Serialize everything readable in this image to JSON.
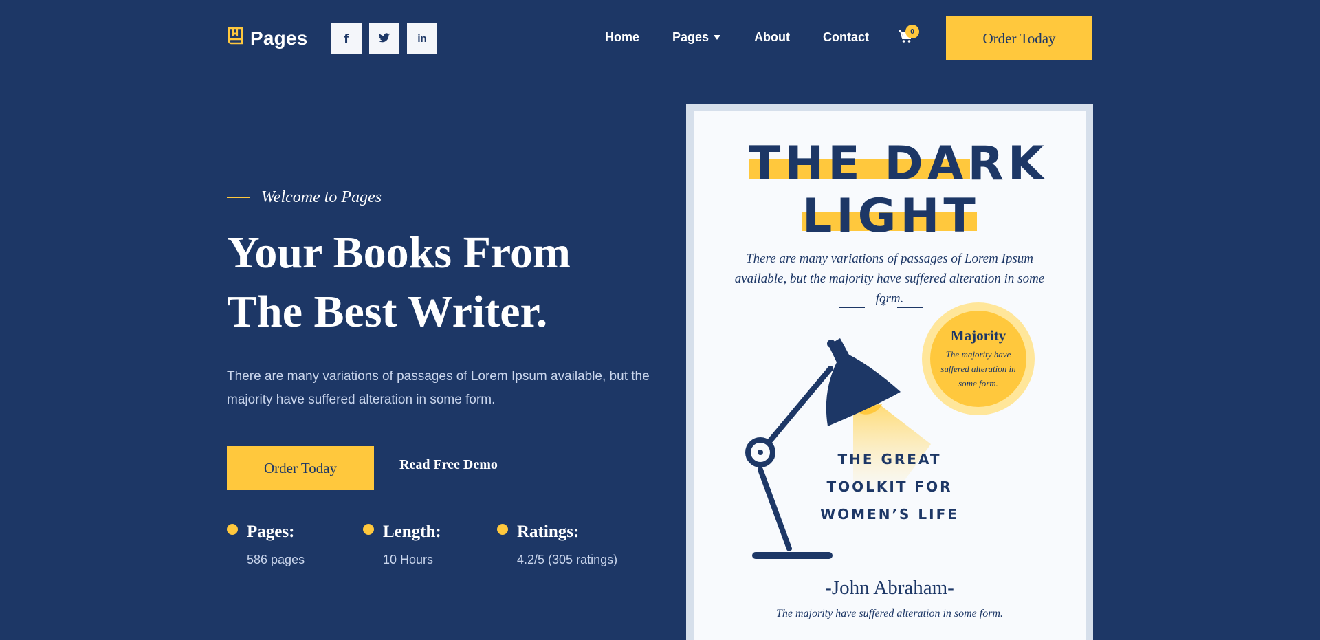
{
  "header": {
    "logo_text": "Pages",
    "logo_icon": "book-icon",
    "socials": [
      {
        "name": "facebook",
        "glyph": "f"
      },
      {
        "name": "twitter",
        "glyph": "twitter-bird"
      },
      {
        "name": "linkedin",
        "glyph": "in"
      }
    ],
    "nav": [
      {
        "label": "Home"
      },
      {
        "label": "Pages",
        "has_dropdown": true
      },
      {
        "label": "About"
      },
      {
        "label": "Contact"
      }
    ],
    "cart_count": "0",
    "order_label": "Order Today"
  },
  "hero": {
    "welcome": "Welcome to Pages",
    "title_line1": "Your Books From",
    "title_line2": "The Best Writer.",
    "description": "There are many variations of passages of Lorem Ipsum available, but the majority have suffered alteration in some form.",
    "order_label": "Order Today",
    "demo_label": "Read Free Demo",
    "stats": [
      {
        "label": "Pages:",
        "value": "586 pages"
      },
      {
        "label": "Length:",
        "value": "10 Hours"
      },
      {
        "label": "Ratings:",
        "value": "4.2/5 (305 ratings)"
      }
    ]
  },
  "book": {
    "title_line1": "THE DARK",
    "title_line2": "LIGHT",
    "description": "There are many variations of passages of Lorem Ipsum available, but the majority have suffered alteration in some form.",
    "badge_title": "Majority",
    "badge_text": "The majority have suffered alteration in some form.",
    "subtitle": "THE GREAT TOOLKIT FOR WOMEN’S LIFE",
    "author": "-John Abraham-",
    "tagline": "The majority have suffered alteration in some form."
  },
  "colors": {
    "background": "#1d3766",
    "accent": "#ffc83d",
    "text_muted": "#c9d5ec",
    "cover": "#f8fafd"
  }
}
